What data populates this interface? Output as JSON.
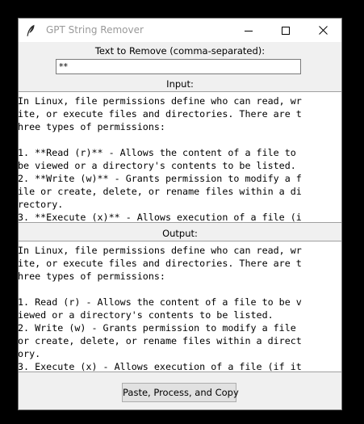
{
  "window": {
    "title": "GPT String Remover",
    "icon": "feather-icon"
  },
  "remove_section": {
    "label": "Text to Remove (comma-separated):",
    "value": "**"
  },
  "input_section": {
    "label": "Input:",
    "lines": [
      "In Linux, file permissions define who can read, wr",
      "ite, or execute files and directories. There are t",
      "hree types of permissions:",
      "",
      "1. **Read (r)** - Allows the content of a file to ",
      "be viewed or a directory's contents to be listed. ",
      "2. **Write (w)** - Grants permission to modify a f",
      "ile or create, delete, or rename files within a di",
      "rectory.",
      "3. **Execute (x)** - Allows execution of a file (i"
    ]
  },
  "output_section": {
    "label": "Output:",
    "lines": [
      "In Linux, file permissions define who can read, wr",
      "ite, or execute files and directories. There are t",
      "hree types of permissions:",
      "",
      "1. Read (r) - Allows the content of a file to be v",
      "iewed or a directory's contents to be listed.",
      "2. Write (w) - Grants permission to modify a file ",
      "or create, delete, or rename files within a direct",
      "ory.",
      "3. Execute (x) - Allows execution of a file (if it"
    ]
  },
  "actions": {
    "process_button_label": "Paste, Process, and Copy"
  }
}
